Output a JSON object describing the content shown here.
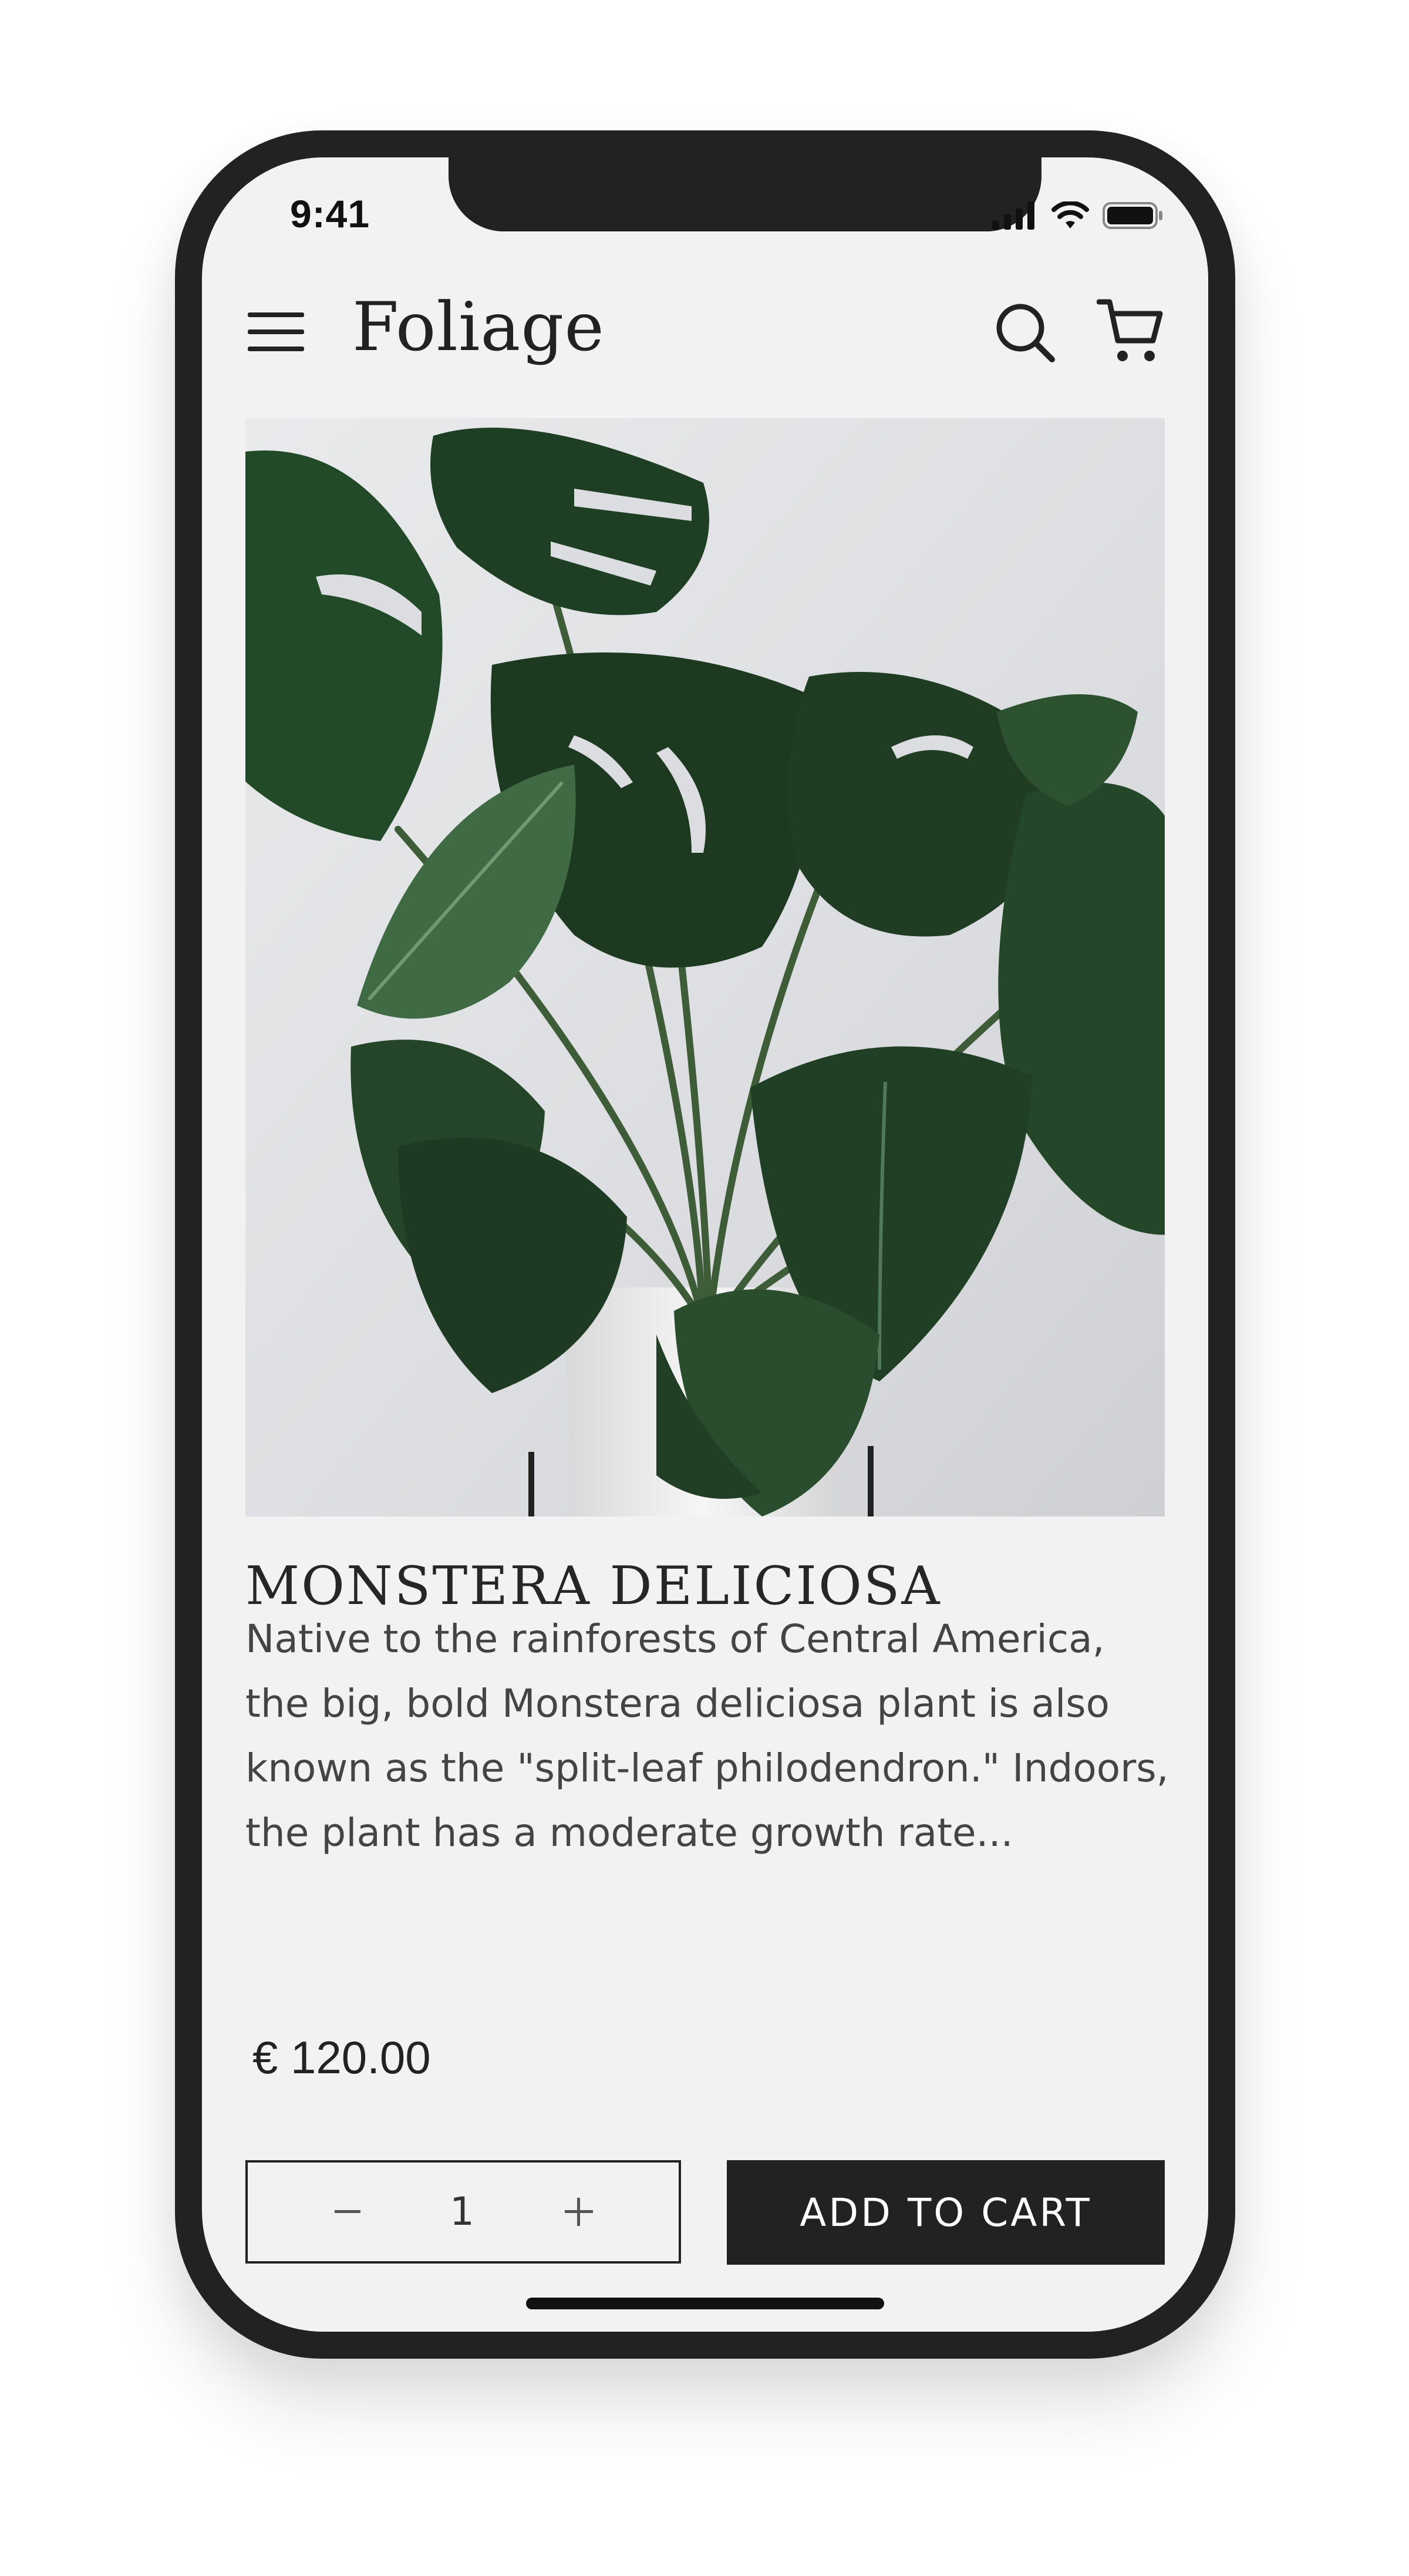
{
  "status_bar": {
    "time": "9:41",
    "signal_icon": "cellular-signal-icon",
    "wifi_icon": "wifi-icon",
    "battery_icon": "battery-icon"
  },
  "header": {
    "brand": "Foliage",
    "menu_icon": "hamburger-menu-icon",
    "search_icon": "search-icon",
    "cart_icon": "shopping-cart-icon"
  },
  "product": {
    "image_subject": "monstera-plant-photo",
    "title": "MONSTERA DELICIOSA",
    "description": "Native to the rainforests of Central America, the big, bold Monstera deliciosa plant is also known as the \"split-leaf philodendron.\" Indoors, the plant has a moderate growth rate...",
    "price": "€ 120.00"
  },
  "quantity": {
    "minus_label": "−",
    "value": "1",
    "plus_label": "+"
  },
  "actions": {
    "add_to_cart": "ADD TO CART"
  },
  "colors": {
    "screen_background": "#f2f2f3",
    "frame": "#222222",
    "button_background": "#222222",
    "button_text": "#ffffff",
    "leaf_dark": "#1f3a22",
    "leaf_mid": "#2f5233"
  }
}
